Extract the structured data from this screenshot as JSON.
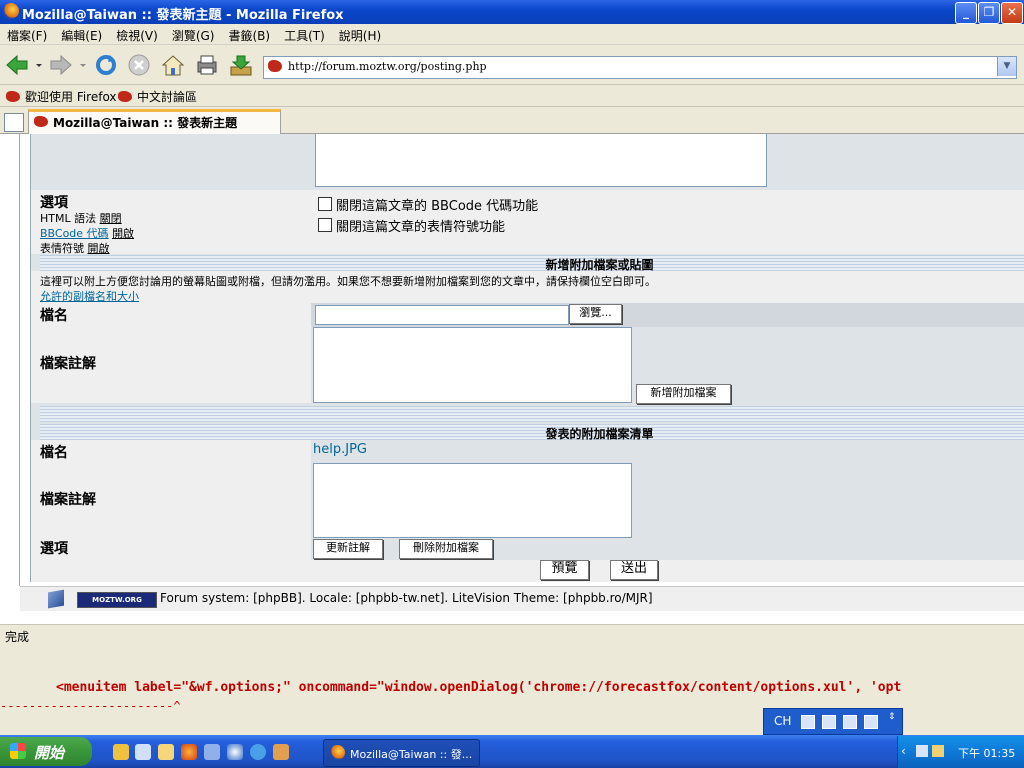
{
  "window": {
    "title": "Mozilla@Taiwan :: 發表新主題 - Mozilla Firefox",
    "minimize": "_",
    "maximize": "❐",
    "close": "✕"
  },
  "menu": [
    "檔案(F)",
    "編輯(E)",
    "檢視(V)",
    "瀏覽(G)",
    "書籤(B)",
    "工具(T)",
    "說明(H)"
  ],
  "toolbar": {
    "url": "http://forum.moztw.org/posting.php"
  },
  "bookmarks": [
    "歡迎使用 Firefox",
    "中文討論區"
  ],
  "tab": {
    "title": "Mozilla@Taiwan :: 發表新主題"
  },
  "options": {
    "title": "選項",
    "html_label": "HTML 語法",
    "html_state": "關閉",
    "bbcode_label": "BBCode 代碼",
    "bbcode_state": "開啟",
    "smilies_label": "表情符號",
    "smilies_state": "開啟",
    "disable_bbcode": "關閉這篇文章的 BBCode 代碼功能",
    "disable_smilies": "關閉這篇文章的表情符號功能"
  },
  "attach": {
    "header": "新增附加檔案或貼圖",
    "explain": "這裡可以附上方便您討論用的螢幕貼圖或附檔，但請勿濫用。如果您不想要新增附加檔案到您的文章中，請保持欄位空白即可。",
    "allowed_link": "允許的副檔名和大小",
    "filename_label": "檔名",
    "browse": "瀏覽...",
    "comment_label": "檔案註解",
    "add_button": "新增附加檔案"
  },
  "posted": {
    "header": "發表的附加檔案清單",
    "filename_label": "檔名",
    "filename": "help.JPG",
    "comment_label": "檔案註解",
    "options_label": "選項",
    "update_button": "更新註解",
    "delete_button": "刪除附加檔案"
  },
  "actions": {
    "preview": "預覽",
    "submit": "送出"
  },
  "footer": {
    "badge": "MOZTW.ORG",
    "text": "Forum system: [phpBB]. Locale: [phpbb-tw.net]. LiteVision Theme: [phpbb.ro/MJR]"
  },
  "status": "完成",
  "console": {
    "line1": "<menuitem label=\"&wf.options;\" oncommand=\"window.openDialog('chrome://forecastfox/content/options.xul', 'opt",
    "line2": "------------------------^"
  },
  "langbar": {
    "lang": "CH"
  },
  "taskbar": {
    "start": "開始",
    "task": "Mozilla@Taiwan :: 發...",
    "clock": "下午 01:35"
  },
  "colors": {
    "link": "#006699",
    "error": "#c00000",
    "titlebar": "#0a47c9"
  }
}
